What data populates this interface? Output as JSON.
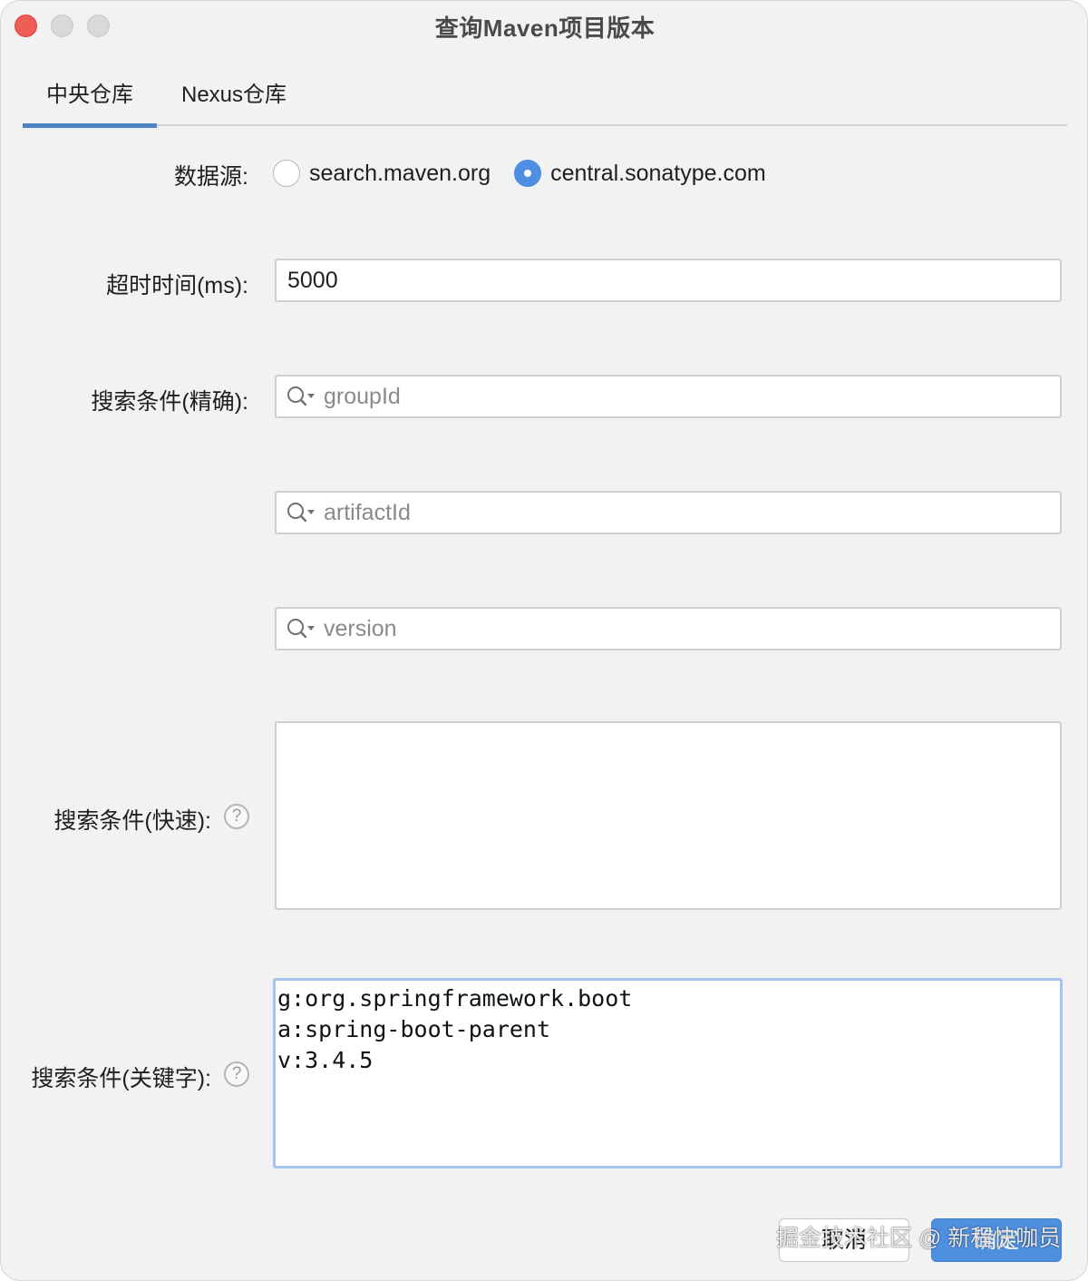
{
  "window": {
    "title": "查询Maven项目版本"
  },
  "tabs": [
    {
      "label": "中央仓库",
      "selected": true
    },
    {
      "label": "Nexus仓库",
      "selected": false
    }
  ],
  "form": {
    "datasource": {
      "label": "数据源:",
      "options": [
        {
          "label": "search.maven.org",
          "checked": false
        },
        {
          "label": "central.sonatype.com",
          "checked": true
        }
      ]
    },
    "timeout": {
      "label": "超时时间(ms):",
      "value": "5000"
    },
    "exact_search": {
      "label": "搜索条件(精确):",
      "groupid_placeholder": "groupId",
      "artifactid_placeholder": "artifactId",
      "version_placeholder": "version"
    },
    "quick_search": {
      "label": "搜索条件(快速):",
      "help": "?",
      "value": ""
    },
    "keyword_search": {
      "label": "搜索条件(关键字):",
      "help": "?",
      "lines": [
        "g:org.springframework.boot",
        "a:spring-boot-parent",
        "v:3.4.5"
      ]
    }
  },
  "buttons": {
    "cancel_label": "取消",
    "ok_label": "确定"
  },
  "watermark": "掘金技术社区 @ 新程快咖员",
  "colors": {
    "accent": "#4d82c4",
    "primary_button": "#4f8fe0",
    "close_button": "#ee5e57",
    "focus_ring": "#a7c5ec"
  }
}
